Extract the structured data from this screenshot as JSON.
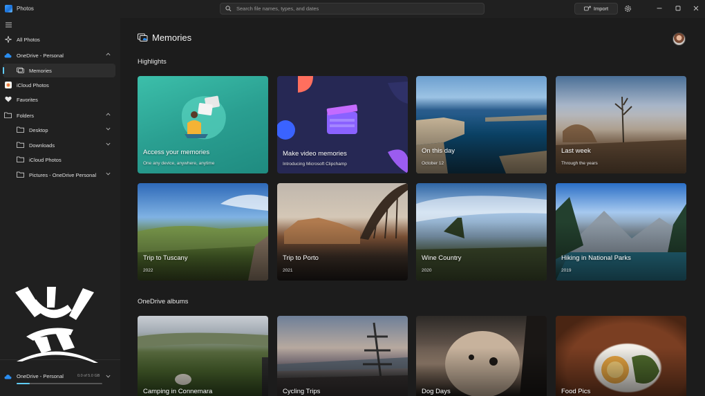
{
  "app": {
    "title": "Photos"
  },
  "search": {
    "placeholder": "Search file names, types, and dates"
  },
  "toolbar": {
    "import_label": "Import"
  },
  "sidebar": {
    "items": [
      {
        "label": "All Photos"
      },
      {
        "label": "OneDrive - Personal"
      },
      {
        "label": "Memories"
      },
      {
        "label": "iCloud Photos"
      },
      {
        "label": "Favorites"
      },
      {
        "label": "Folders"
      },
      {
        "label": "Desktop"
      },
      {
        "label": "Downloads"
      },
      {
        "label": "iCloud Photos"
      },
      {
        "label": "Pictures - OneDrive Personal"
      }
    ],
    "footer": {
      "label": "OneDrive - Personal",
      "quota": "0.0 of 5.0 GB",
      "used_fraction": 0.15
    }
  },
  "main": {
    "title": "Memories",
    "highlights": {
      "title": "Highlights",
      "cards": [
        {
          "title": "Access your memories",
          "subtitle": "One any device, anywhere, anytime"
        },
        {
          "title": "Make video memories",
          "subtitle": "Introducing Microsoft Clipchamp"
        },
        {
          "title": "On this day",
          "subtitle": "October 12"
        },
        {
          "title": "Last week",
          "subtitle": "Through the years"
        },
        {
          "title": "Trip to Tuscany",
          "subtitle": "2022"
        },
        {
          "title": "Trip to Porto",
          "subtitle": "2021"
        },
        {
          "title": "Wine Country",
          "subtitle": "2020"
        },
        {
          "title": "Hiking in National Parks",
          "subtitle": "2019"
        }
      ]
    },
    "albums": {
      "title": "OneDrive albums",
      "cards": [
        {
          "title": "Camping in Connemara"
        },
        {
          "title": "Cycling Trips"
        },
        {
          "title": "Dog Days"
        },
        {
          "title": "Food Pics"
        }
      ]
    }
  },
  "colors": {
    "accent": "#60cdff",
    "sidebar_bg": "#202020",
    "main_bg": "#1c1c1c"
  }
}
